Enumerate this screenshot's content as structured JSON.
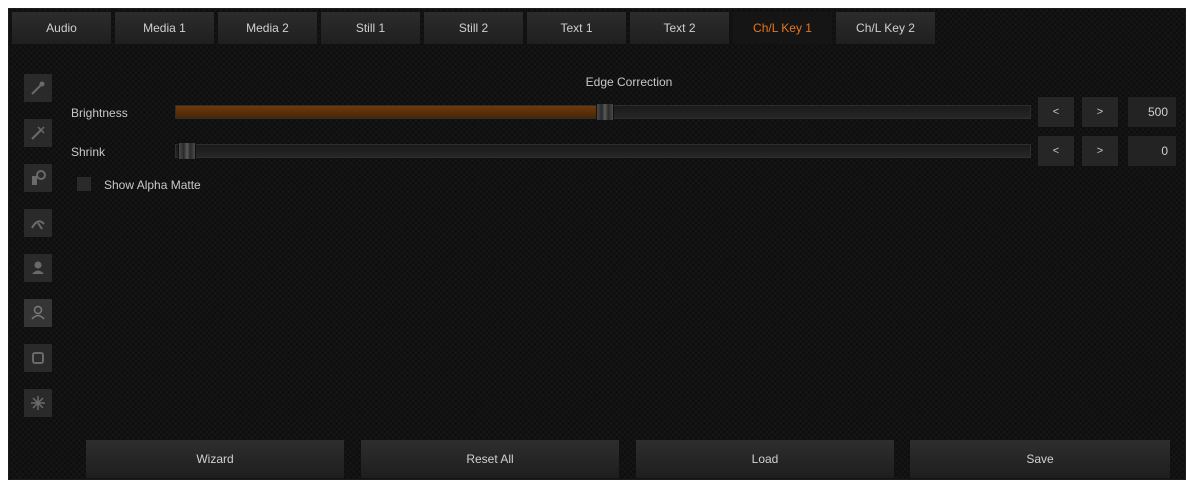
{
  "tabs": [
    {
      "label": "Audio"
    },
    {
      "label": "Media 1"
    },
    {
      "label": "Media 2"
    },
    {
      "label": "Still 1"
    },
    {
      "label": "Still 2"
    },
    {
      "label": "Text 1"
    },
    {
      "label": "Text 2"
    },
    {
      "label": "Ch/L Key 1"
    },
    {
      "label": "Ch/L Key 2"
    }
  ],
  "active_tab": "Ch/L Key 1",
  "accent_color": "#e8761c",
  "sidebar": {
    "icons": [
      "wand-icon",
      "wand-crossed-icon",
      "color-picker-icon",
      "cursor-arrow-icon",
      "person-icon",
      "person-outline-icon",
      "crop-icon",
      "sparkle-icon"
    ]
  },
  "section_title": "Edge Correction",
  "brightness": {
    "label": "Brightness",
    "value": "500",
    "fill_fraction": 0.49,
    "decrement": "<",
    "increment": ">"
  },
  "shrink": {
    "label": "Shrink",
    "value": "0",
    "fill_fraction": 0.0,
    "decrement": "<",
    "increment": ">"
  },
  "show_alpha_matte": {
    "label": "Show Alpha Matte",
    "checked": false
  },
  "buttons": {
    "wizard": "Wizard",
    "reset_all": "Reset All",
    "load": "Load",
    "save": "Save"
  }
}
